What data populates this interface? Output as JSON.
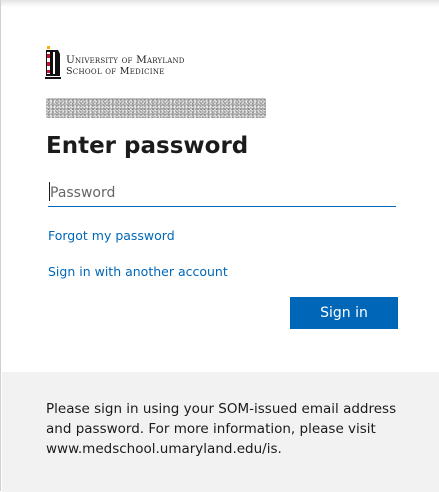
{
  "branding": {
    "logo_line1": "University of Maryland",
    "logo_line2": "School of Medicine",
    "flag_icon": "maryland-flag-emblem-icon"
  },
  "account": {
    "email": ""
  },
  "form": {
    "title": "Enter password",
    "password_placeholder": "Password",
    "password_value": "",
    "forgot_link": "Forgot my password",
    "another_account_link": "Sign in with another account",
    "sign_in_button": "Sign in"
  },
  "footer": {
    "message": "Please sign in using your SOM-issued email address and password. For more information, please visit www.medschool.umaryland.edu/is."
  },
  "colors": {
    "accent": "#0067b8",
    "footer_bg": "#f2f2f2",
    "text": "#1b1b1b"
  }
}
